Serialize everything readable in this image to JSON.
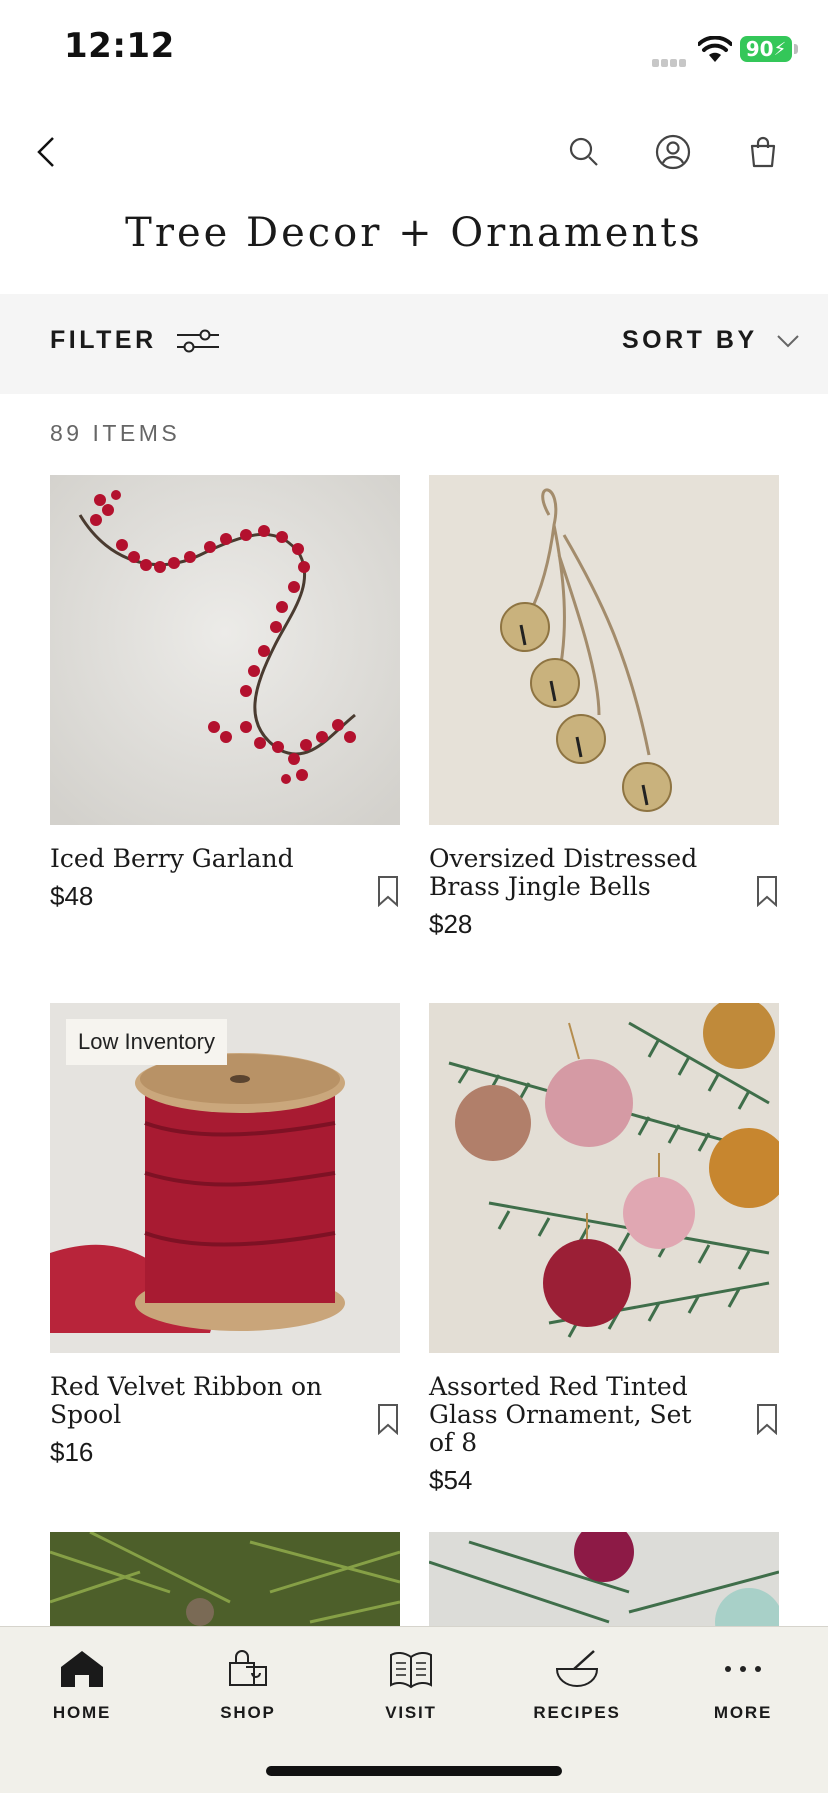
{
  "status_bar": {
    "time": "12:12",
    "battery": "90"
  },
  "header": {
    "title": "Tree Decor + Ornaments"
  },
  "toolbar": {
    "filter_label": "FILTER",
    "sort_label": "SORT BY"
  },
  "results": {
    "count_label": "89 ITEMS"
  },
  "products": [
    {
      "name": "Iced Berry Garland",
      "price": "$48",
      "badge": ""
    },
    {
      "name": "Oversized Distressed Brass Jingle Bells",
      "price": "$28",
      "badge": ""
    },
    {
      "name": "Red Velvet Ribbon on Spool",
      "price": "$16",
      "badge": "Low Inventory"
    },
    {
      "name": "Assorted Red Tinted Glass Ornament, Set of 8",
      "price": "$54",
      "badge": ""
    }
  ],
  "bottom_nav": [
    {
      "label": "HOME",
      "icon": "home-icon"
    },
    {
      "label": "SHOP",
      "icon": "shopping-bag-icon"
    },
    {
      "label": "VISIT",
      "icon": "map-book-icon"
    },
    {
      "label": "RECIPES",
      "icon": "mortar-icon"
    },
    {
      "label": "MORE",
      "icon": "more-icon"
    }
  ],
  "colors": {
    "filter_bar_bg": "#f5f5f5",
    "nav_bg": "#f1f0ea",
    "battery": "#34c759"
  }
}
